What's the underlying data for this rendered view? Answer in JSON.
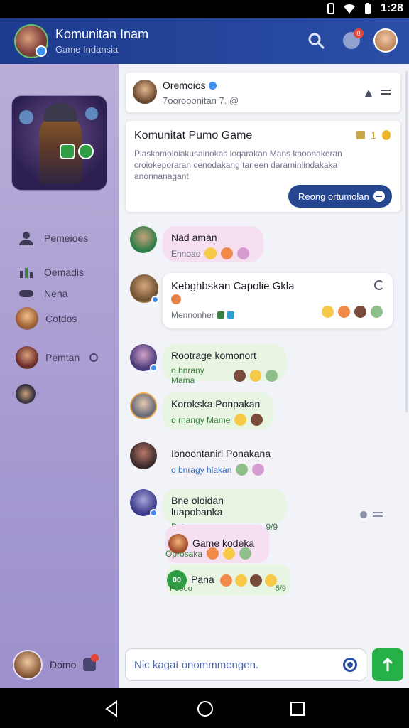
{
  "status": {
    "time": "1:28"
  },
  "header": {
    "title": "Komunitan Inam",
    "subtitle": "Game Indansia",
    "notif_count": "0"
  },
  "sidebar": {
    "items": [
      {
        "label": "Pemeioes",
        "icon": "people-icon"
      },
      {
        "label": "Oemadis",
        "icon": "chart-icon"
      },
      {
        "label": "Nena",
        "icon": "gamepad-icon"
      },
      {
        "label": "Cotdos",
        "icon": "avatar"
      },
      {
        "label": "Pemtan",
        "icon": "avatar"
      }
    ],
    "user": {
      "name": "Domo"
    }
  },
  "feed": {
    "post1": {
      "name": "Oremoios",
      "meta": "7oorooonitan 7. @"
    },
    "post2": {
      "title": "Komunitat Pumo Game",
      "react_count": "1",
      "body": "Plaskomoloiakusainokas loqarakan Mans kaoonakeran croiokeporaran cenodakang taneen daraminlindakaka anonnanagant",
      "button": "Reong ortumolan"
    },
    "msg1": {
      "text": "Nad aman",
      "sub": "Ennoao"
    },
    "msg2": {
      "text": "Kebghbskan Capolie Gkla",
      "sub": "Mennonher"
    },
    "msg3": {
      "text": "Rootrage komonort",
      "sub": "o bnrany Mama"
    },
    "msg4": {
      "text": "Korokska Ponpakan",
      "sub": "o rnangy Mame"
    },
    "msg5": {
      "text": "Ibnoontanirl Ponakana",
      "sub": "o bnragy hlakan"
    },
    "msg6": {
      "text": "Bne oloidan luapobanka",
      "sub": "Patmae",
      "sub_right": "9/9"
    },
    "reply1": {
      "text": "Game kodeka",
      "sub": "Oprosaka"
    },
    "reply2": {
      "text": "Pana",
      "tag": "00",
      "foot_left": "Poooo",
      "foot_right": "5/9"
    }
  },
  "composer": {
    "placeholder": "Nic kagat onommmengen."
  }
}
